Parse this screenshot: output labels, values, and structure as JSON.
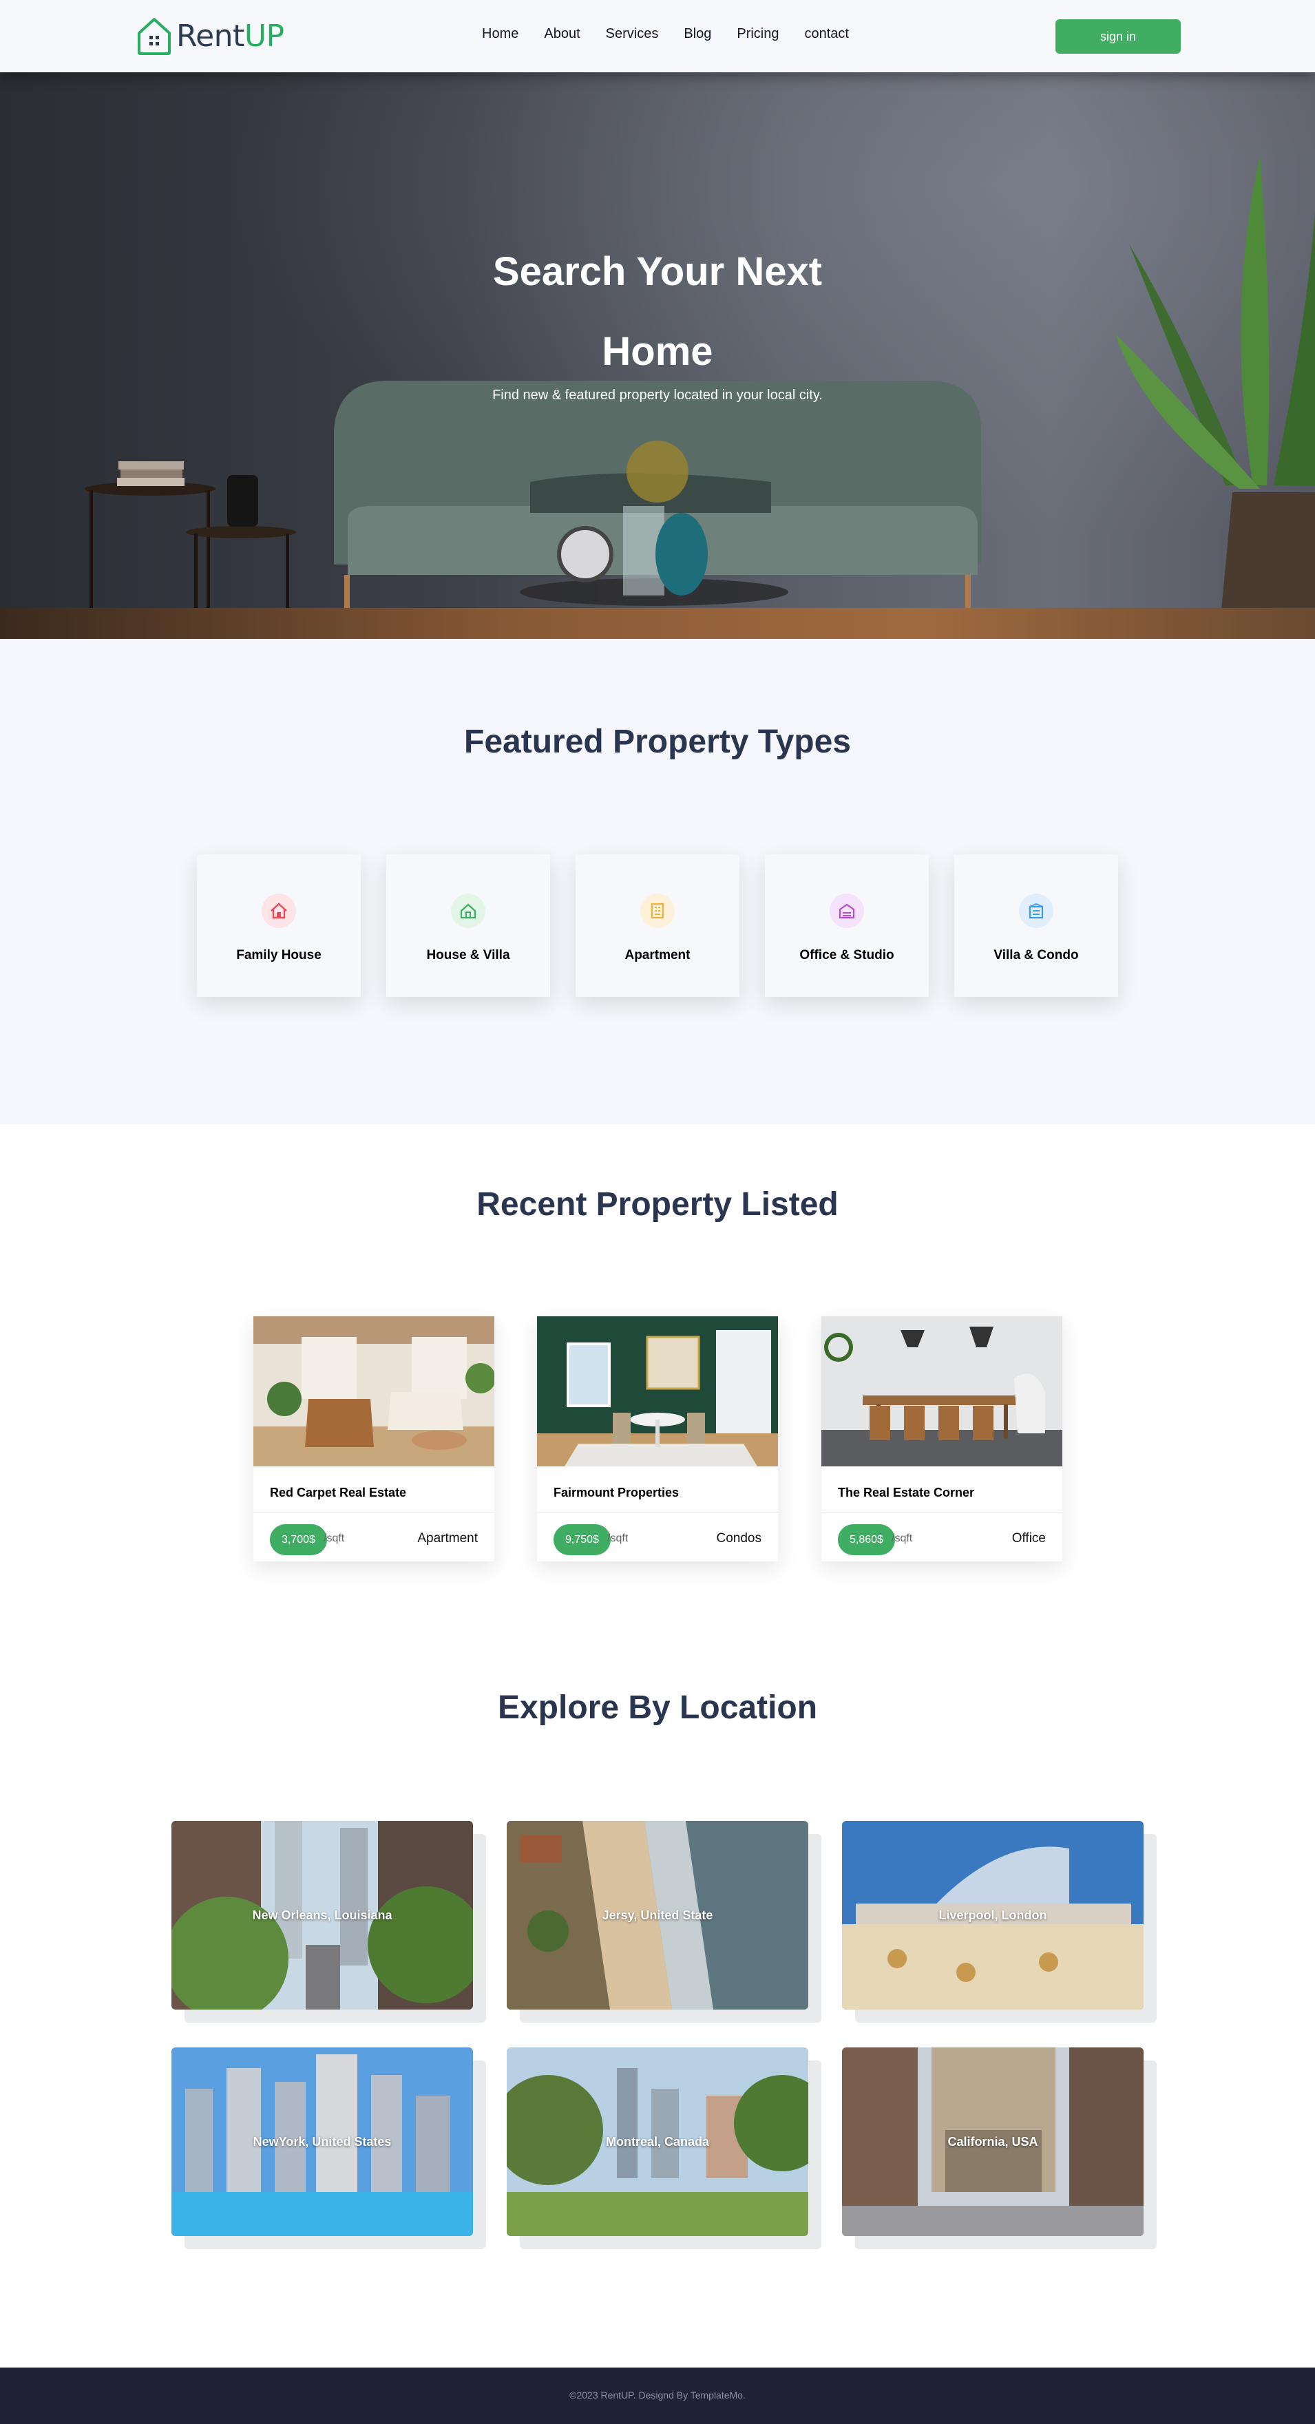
{
  "header": {
    "logo_text_main": "Rent",
    "logo_text_accent": "UP",
    "nav": [
      "Home",
      "About",
      "Services",
      "Blog",
      "Pricing",
      "contact"
    ],
    "signin_label": "sign in",
    "accent_color": "#3fae62"
  },
  "hero": {
    "title_line1": "Search Your Next",
    "title_line2": "Home",
    "subtitle": "Find new & featured property located in your local city."
  },
  "featured": {
    "title": "Featured Property Types",
    "types": [
      {
        "label": "Family House",
        "icon": "house-icon",
        "color": "#e74c5c",
        "bg": "#fde4e6"
      },
      {
        "label": "House & Villa",
        "icon": "villa-icon",
        "color": "#3fae62",
        "bg": "#e2f5e7"
      },
      {
        "label": "Apartment",
        "icon": "apartment-icon",
        "color": "#f2b33d",
        "bg": "#fdf1da"
      },
      {
        "label": "Office & Studio",
        "icon": "office-icon",
        "color": "#b24fd6",
        "bg": "#f4e3fa"
      },
      {
        "label": "Villa & Condo",
        "icon": "condo-icon",
        "color": "#3b9ee6",
        "bg": "#e1eefb"
      }
    ]
  },
  "recent": {
    "title": "Recent Property Listed",
    "properties": [
      {
        "name": "Red Carpet Real Estate",
        "price": "3,700$",
        "unit": "/sqft",
        "type": "Apartment"
      },
      {
        "name": "Fairmount Properties",
        "price": "9,750$",
        "unit": "/sqft",
        "type": "Condos"
      },
      {
        "name": "The Real Estate Corner",
        "price": "5,860$",
        "unit": "/sqft",
        "type": "Office"
      }
    ]
  },
  "locations": {
    "title": "Explore By Location",
    "items": [
      "New Orleans, Louisiana",
      "Jersy, United State",
      "Liverpool, London",
      "NewYork, United States",
      "Montreal, Canada",
      "California, USA"
    ]
  },
  "footer": {
    "text": "©2023 RentUP. Designd By TemplateMo."
  }
}
